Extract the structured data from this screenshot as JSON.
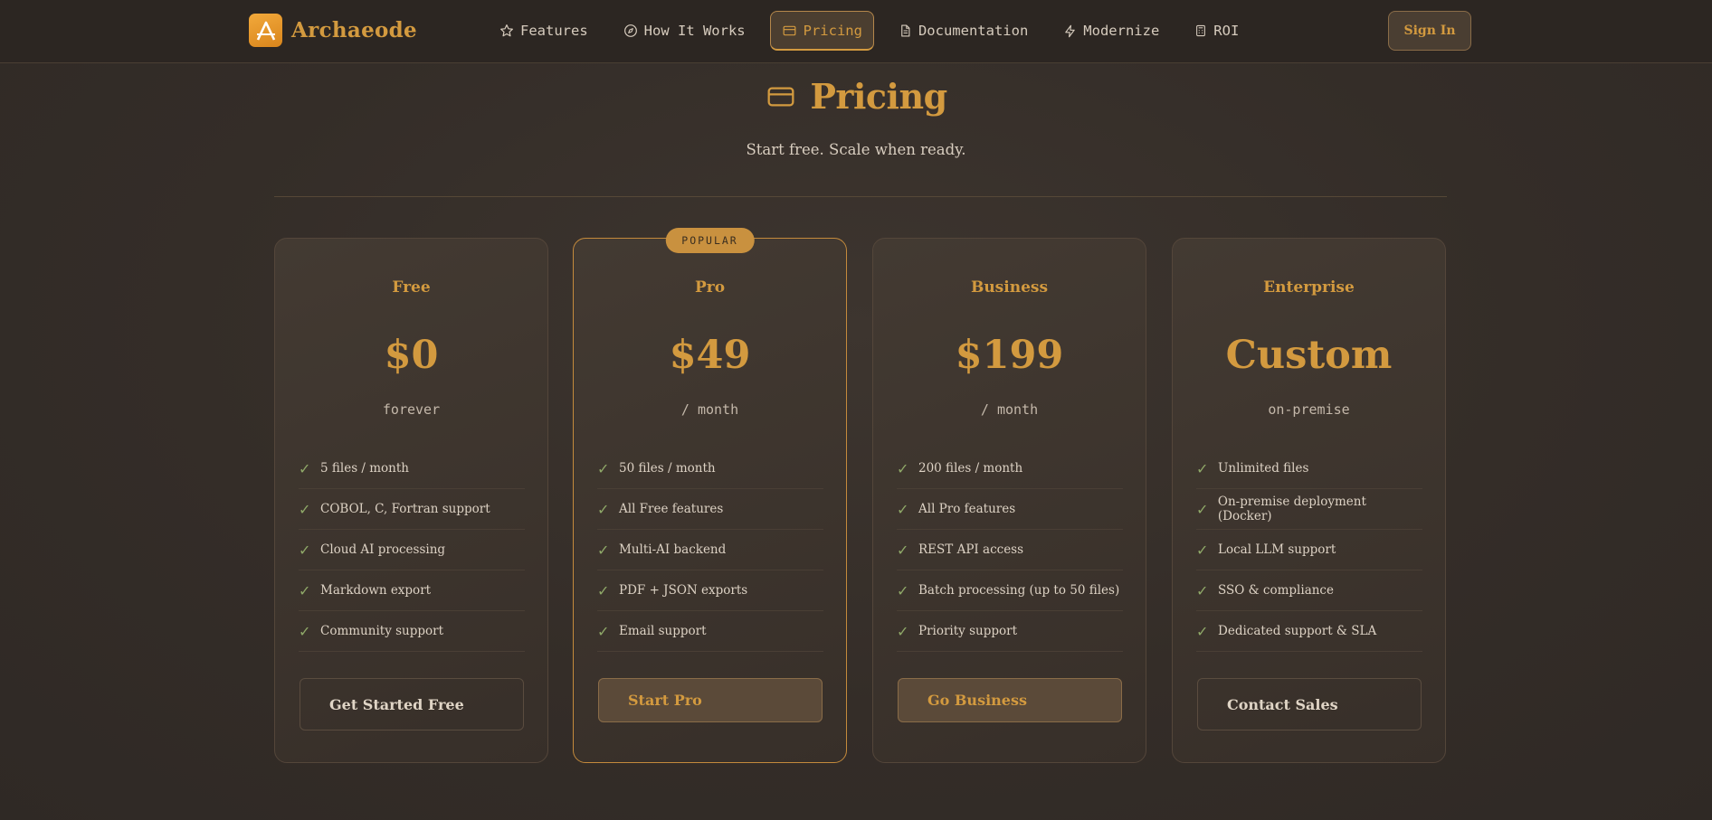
{
  "app": {
    "brand": "Archaeode"
  },
  "nav": {
    "items": [
      {
        "label": "Features",
        "icon": "star-icon"
      },
      {
        "label": "How It Works",
        "icon": "compass-icon"
      },
      {
        "label": "Pricing",
        "icon": "credit-card-icon",
        "active": true
      },
      {
        "label": "Documentation",
        "icon": "document-icon"
      },
      {
        "label": "Modernize",
        "icon": "lightning-icon"
      },
      {
        "label": "ROI",
        "icon": "calculator-icon"
      }
    ],
    "signin_label": "Sign In"
  },
  "header": {
    "title": "Pricing",
    "subtitle": "Start free. Scale when ready."
  },
  "plans": [
    {
      "name": "Free",
      "price": "$0",
      "period": "forever",
      "features": [
        "5 files / month",
        "COBOL, C, Fortran support",
        "Cloud AI processing",
        "Markdown export",
        "Community support"
      ],
      "cta": "Get Started Free"
    },
    {
      "name": "Pro",
      "price": "$49",
      "period": "/ month",
      "badge": "POPULAR",
      "features": [
        "50 files / month",
        "All Free features",
        "Multi-AI backend",
        "PDF + JSON exports",
        "Email support"
      ],
      "cta": "Start Pro"
    },
    {
      "name": "Business",
      "price": "$199",
      "period": "/ month",
      "features": [
        "200 files / month",
        "All Pro features",
        "REST API access",
        "Batch processing (up to 50 files)",
        "Priority support"
      ],
      "cta": "Go Business"
    },
    {
      "name": "Enterprise",
      "price": "Custom",
      "period": "on-premise",
      "features": [
        "Unlimited files",
        "On-premise deployment (Docker)",
        "Local LLM support",
        "SSO & compliance",
        "Dedicated support & SLA"
      ],
      "cta": "Contact Sales"
    }
  ],
  "colors": {
    "accent": "#d39a3f",
    "background": "#342d28",
    "check": "#8fa868"
  }
}
